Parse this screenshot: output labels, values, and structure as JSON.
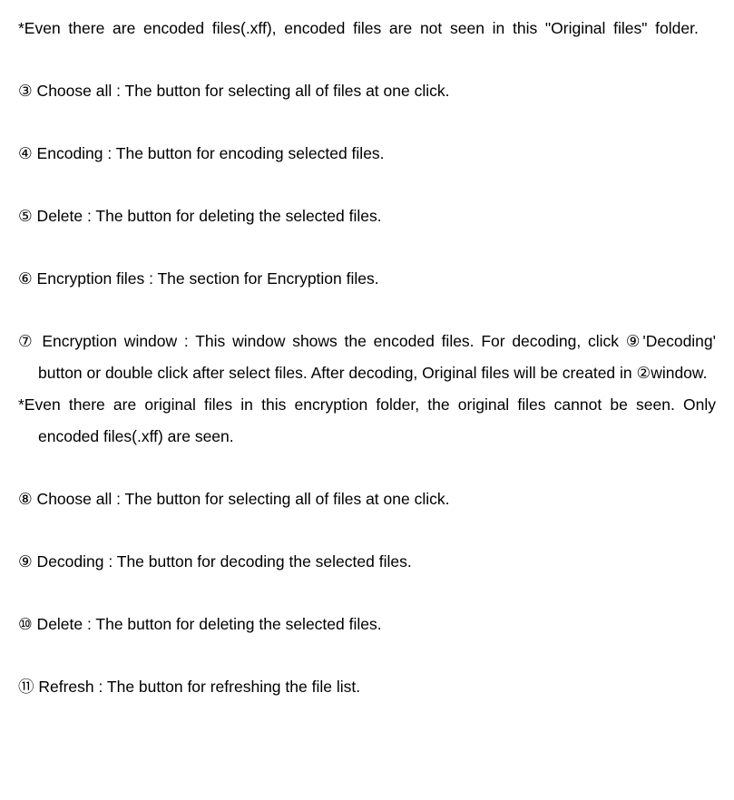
{
  "paragraphs": {
    "note1": "*Even there are encoded files(.xff), encoded files are not seen in this \"Original files\" folder.",
    "item3": "③ Choose all : The button for selecting all of files at one click.",
    "item4": "④ Encoding : The button for encoding selected files.",
    "item5": "⑤ Delete : The button for deleting the selected files.",
    "item6": "⑥ Encryption files : The section for Encryption files.",
    "item7": "⑦ Encryption window : This window shows the encoded files. For decoding, click ⑨'Decoding' button or double click after select files. After decoding, Original files will be created in ②window.",
    "note2": "*Even there are original files in this encryption folder, the original files cannot be seen. Only encoded files(.xff) are seen.",
    "item8": "⑧ Choose all : The button for selecting all of files at one click.",
    "item9": "⑨ Decoding : The button for decoding the selected files.",
    "item10": "⑩ Delete : The button for deleting the selected files.",
    "item11": "⑪ Refresh : The button for refreshing the file list."
  }
}
